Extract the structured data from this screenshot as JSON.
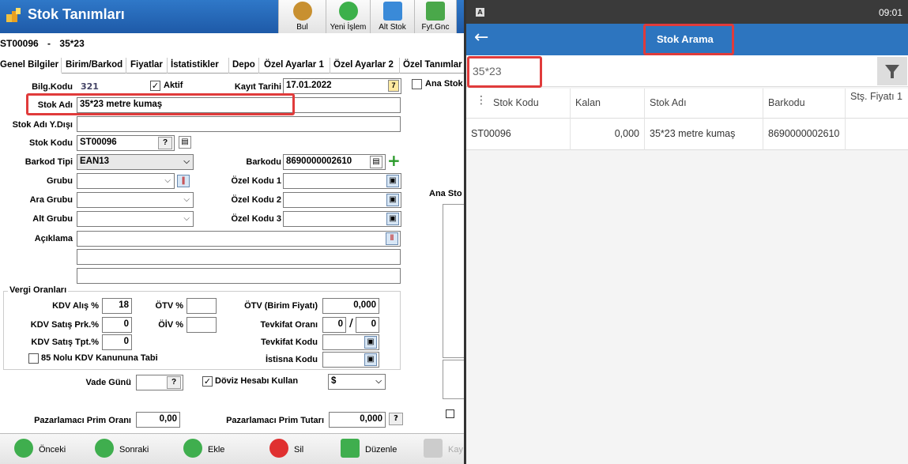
{
  "app": {
    "title": "Stok Tanımları",
    "toolbar": [
      "Bul",
      "Yeni İşlem",
      "Alt Stok",
      "Fyt.Gnc"
    ],
    "record_code": "ST00096",
    "record_sep": "-",
    "record_name": "35*23",
    "tabs": [
      "Genel Bilgiler",
      "Birim/Barkod",
      "Fiyatlar",
      "İstatistikler",
      "Depo",
      "Özel Ayarlar 1",
      "Özel Ayarlar 2",
      "Özel Tanımlar"
    ],
    "fields": {
      "bilg_kodu_label": "Bilg.Kodu",
      "bilg_kodu": "321",
      "aktif_label": "Aktif",
      "kayit_tarihi_label": "Kayıt Tarihi",
      "kayit_tarihi": "17.01.2022",
      "stok_adi_label": "Stok Adı",
      "stok_adi": "35*23 metre kumaş",
      "stok_adi_ydisi_label": "Stok Adı Y.Dışı",
      "stok_kodu_label": "Stok Kodu",
      "stok_kodu": "ST00096",
      "barkod_tipi_label": "Barkod Tipi",
      "barkod_tipi": "EAN13",
      "barkodu_label": "Barkodu",
      "barkodu": "8690000002610",
      "grubu_label": "Grubu",
      "ara_grubu_label": "Ara Grubu",
      "alt_grubu_label": "Alt Grubu",
      "ozel_kodu1_label": "Özel Kodu 1",
      "ozel_kodu2_label": "Özel Kodu 2",
      "ozel_kodu3_label": "Özel Kodu 3",
      "aciklama_label": "Açıklama",
      "ana_stok_label": "Ana Stok",
      "ana_stok2_label": "Ana Sto"
    },
    "vergi": {
      "title": "Vergi Oranları",
      "kdv_alis_label": "KDV Alış %",
      "kdv_alis": "18",
      "kdv_satis_prk_label": "KDV Satış Prk.%",
      "kdv_satis_prk": "0",
      "kdv_satis_tpt_label": "KDV Satış Tpt.%",
      "kdv_satis_tpt": "0",
      "otv_label": "ÖTV %",
      "oiv_label": "ÖİV %",
      "otv_birim_label": "ÖTV (Birim Fiyatı)",
      "otv_birim": "0,000",
      "tevkifat_orani_label": "Tevkifat Oranı",
      "tevkifat_a": "0",
      "tevkifat_sep": "/",
      "tevkifat_b": "0",
      "tevkifat_kodu_label": "Tevkifat Kodu",
      "istisna_kodu_label": "İstisna Kodu",
      "kdv85_label": "85 Nolu KDV Kanununa Tabi"
    },
    "vade_gunu_label": "Vade Günü",
    "doviz_label": "Döviz Hesabı Kullan",
    "doviz_value": "$",
    "prim_orani_label": "Pazarlamacı Prim Oranı",
    "prim_orani": "0,00",
    "prim_tutari_label": "Pazarlamacı Prim Tutarı",
    "prim_tutari": "0,000",
    "bottom": [
      "Önceki",
      "Sonraki",
      "Ekle",
      "Sil",
      "Düzenle",
      "Kay"
    ]
  },
  "phone": {
    "status_icon": "A",
    "time": "09:01",
    "title": "Stok Arama",
    "search_value": "35*23",
    "columns": [
      "Stok Kodu",
      "Kalan",
      "Stok Adı",
      "Barkodu",
      "Stş. Fiyatı 1"
    ],
    "rows": [
      {
        "stok_kodu": "ST00096",
        "kalan": "0,000",
        "stok_adi": "35*23 metre kumaş",
        "barkodu": "8690000002610",
        "fiyat": ""
      }
    ]
  },
  "colors": {
    "accent": "#2d75bf",
    "highlight": "#e03b3b"
  }
}
